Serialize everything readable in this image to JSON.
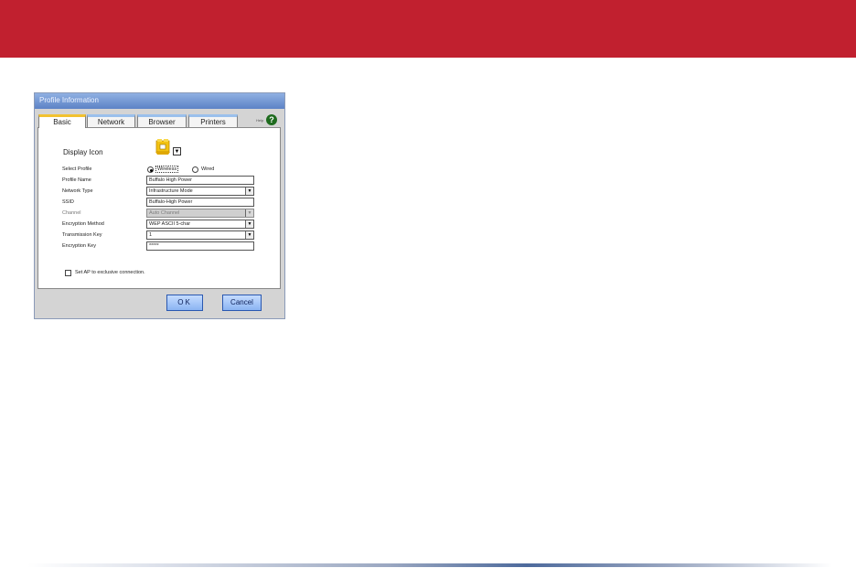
{
  "window": {
    "title": "Profile Information"
  },
  "tabs": [
    {
      "label": "Basic",
      "active": true
    },
    {
      "label": "Network",
      "active": false
    },
    {
      "label": "Browser",
      "active": false
    },
    {
      "label": "Printers",
      "active": false
    }
  ],
  "help": {
    "label": "Help",
    "icon": "help-icon",
    "glyph": "?"
  },
  "form": {
    "display_icon_label": "Display Icon",
    "display_icon_dropdown": "▼",
    "select_profile": {
      "label": "Select Profile",
      "options": [
        {
          "label": "Wireless",
          "selected": true
        },
        {
          "label": "Wired",
          "selected": false
        }
      ]
    },
    "profile_name": {
      "label": "Profile Name",
      "value": "Buffalo High Power"
    },
    "network_type": {
      "label": "Network Type",
      "value": "Infrastructure Mode"
    },
    "ssid": {
      "label": "SSID",
      "value": "Buffalo-High Power"
    },
    "channel": {
      "label": "Channel",
      "value": "Auto Channel",
      "disabled": true
    },
    "encryption_method": {
      "label": "Encryption Method",
      "value": "WEP ASCII 5-char"
    },
    "transmission_key": {
      "label": "Transmission Key",
      "value": "1"
    },
    "encryption_key": {
      "label": "Encryption Key",
      "value": "*****"
    },
    "exclusive": {
      "label": "Set AP to exclusive connection.",
      "checked": false
    }
  },
  "buttons": {
    "ok": "OK",
    "cancel": "Cancel"
  },
  "colors": {
    "banner": "#c1202f",
    "titlebar": "#6a8fd0",
    "active_tab_accent": "#f2c230",
    "button": "#8bb4f2"
  }
}
